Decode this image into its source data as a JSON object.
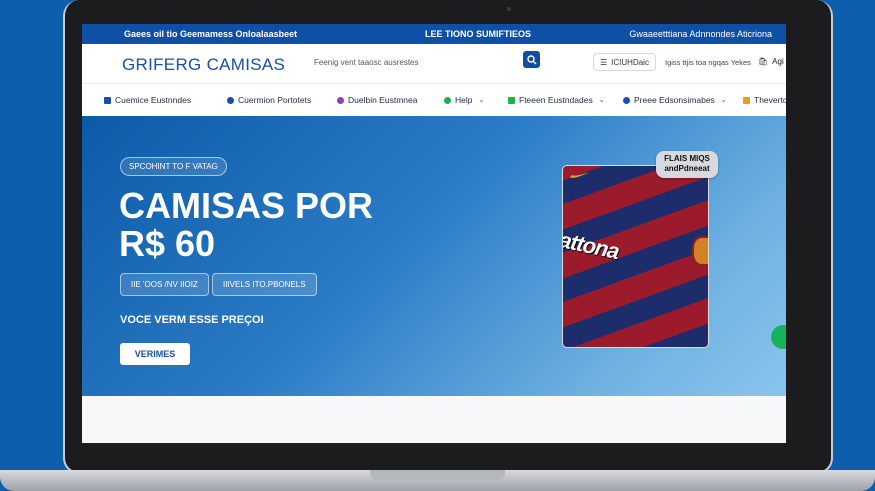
{
  "topbar": {
    "left": "Gaees oil tio Geemamess Onloalaasbeet",
    "center": "LEE TIONO SUMIFTIEOS",
    "right": "Gwaaeetttiana Adnnondes Aticriona"
  },
  "header": {
    "logo": "GRIFERG CAMISAS",
    "search_placeholder": "Feenig vent taaosc  ausrestes",
    "account_label": "ICIUHDaic",
    "help_link": "Igiss  ttjis toa  ngqas  Yekes",
    "cart_label": "Agi"
  },
  "nav": [
    {
      "label": "Cuemice Eustnndes",
      "color": "#1a4fa3"
    },
    {
      "label": "Cuermion Portotets",
      "color": "#1a4fa3"
    },
    {
      "label": "Duelbin Eustmnea",
      "color": "#8e3fb0"
    },
    {
      "label": "Help",
      "color": "#1fb04b"
    },
    {
      "label": "Fteeen Eustndades",
      "color": "#1fb04b"
    },
    {
      "label": "Preee Edsonsimabes",
      "color": "#1a4fa3"
    },
    {
      "label": "Theverto",
      "color": "#e89b1d"
    }
  ],
  "hero": {
    "pill": "SPCOHINT TO F VATAG",
    "title1": "CAMISAS POR",
    "title2": "R$ 60",
    "tag1": "IIE 'OOS /NV IIOIZ",
    "tag2": "IIIVELS ITO.PBONELS",
    "subtitle": "VOCE VERM ESSE PREÇOI",
    "cta": "VERIMES",
    "badge": "FLAIS MIQS andPdneeat",
    "jersey_text": "attona"
  }
}
